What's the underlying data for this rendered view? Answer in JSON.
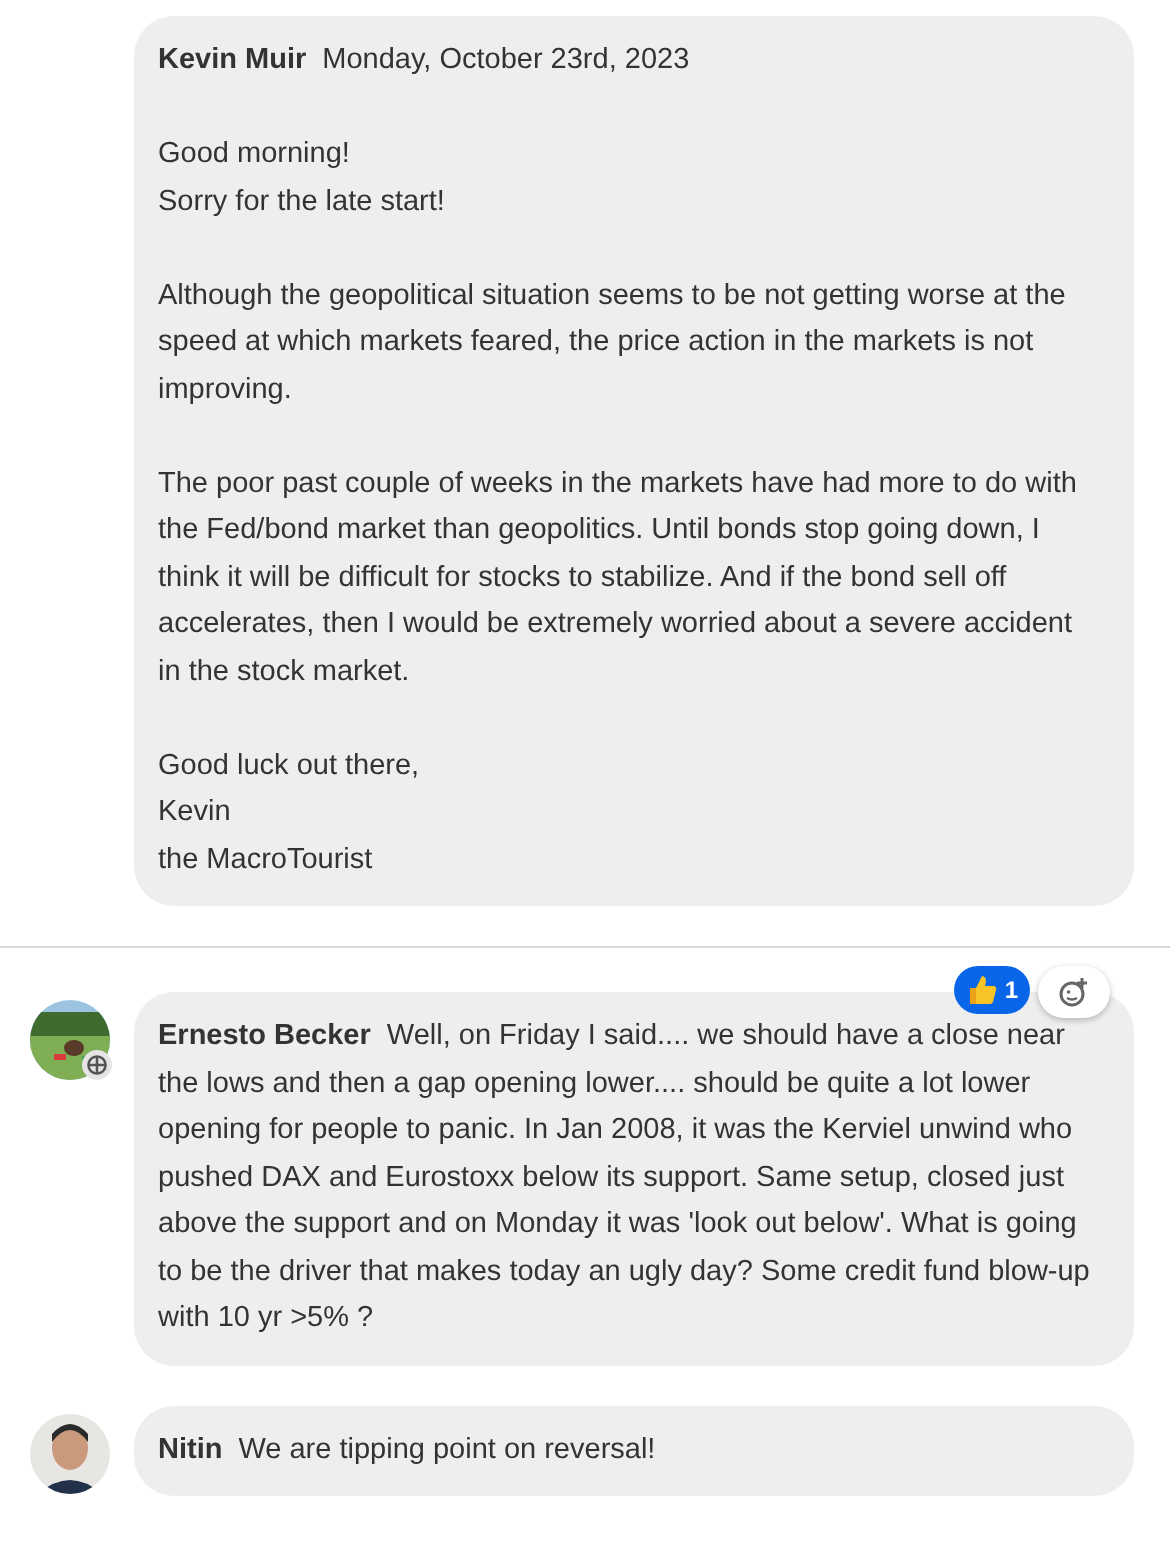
{
  "messages": [
    {
      "author": "Kevin Muir",
      "date": "Monday, October 23rd, 2023",
      "avatar": false,
      "paragraphs": [
        [
          "Good morning!",
          "Sorry for the late start!"
        ],
        [
          "Although the geopolitical situation seems to be not getting worse at the speed at which markets feared, the price action in the markets is not improving."
        ],
        [
          "The poor past couple of weeks in the markets have had more to do with the Fed/bond market than geopolitics. Until bonds stop going down, I think it will be difficult for stocks to stabilize. And if the bond sell off accelerates, then I would be extremely worried about a severe accident in the stock market."
        ],
        [
          "Good luck out there,",
          "Kevin",
          "the MacroTourist"
        ]
      ]
    },
    {
      "author": "Ernesto Becker",
      "avatar": true,
      "avatar_badge": true,
      "divider": true,
      "reaction": {
        "count": "1"
      },
      "paragraphs": [
        [
          "Well, on Friday I said.... we should have a close near the lows and then a gap opening lower.... should be quite a lot lower opening for people to panic. In Jan 2008, it was the Kerviel unwind who pushed DAX and Eurostoxx below its support. Same setup, closed just above the support and on Monday it was 'look out below'. What is going to be the driver that makes today an ugly day? Some credit fund blow-up with 10 yr >5% ?"
        ]
      ]
    },
    {
      "author": "Nitin",
      "avatar": true,
      "avatar_badge": false,
      "paragraphs": [
        [
          "We are tipping point on reversal!"
        ]
      ]
    }
  ]
}
